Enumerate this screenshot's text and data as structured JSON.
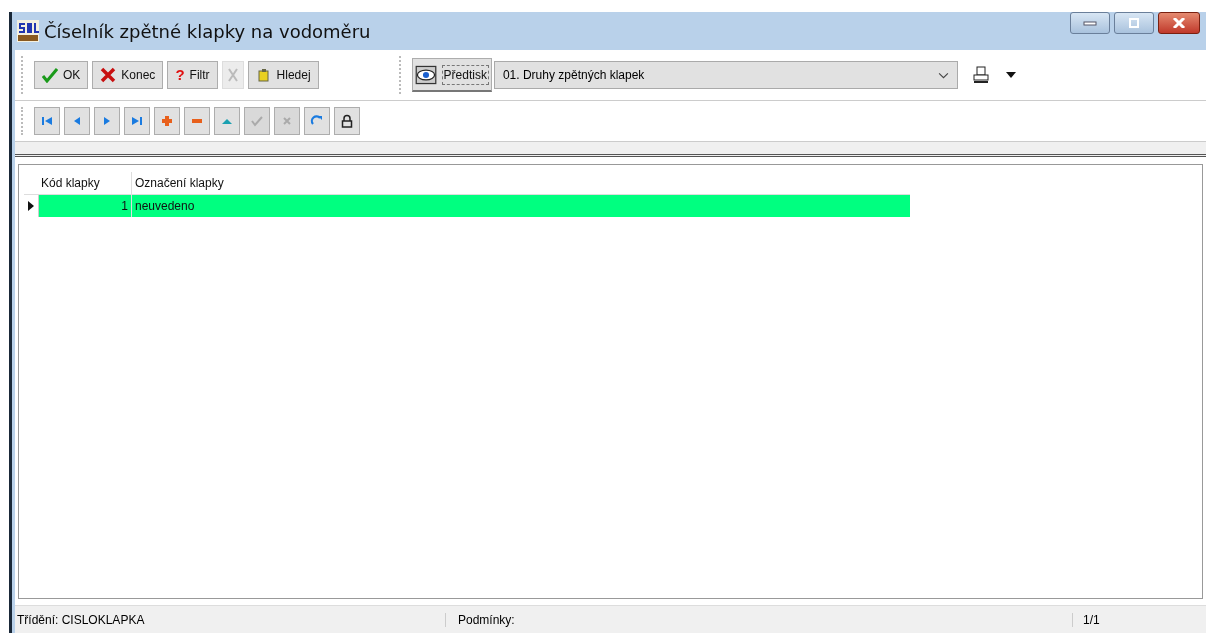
{
  "window": {
    "title": "Číselník zpětné klapky na vodoměru"
  },
  "toolbar": [
    {
      "kind": "ok",
      "label": "OK",
      "disabled": false
    },
    {
      "kind": "close",
      "label": "Konec",
      "disabled": false
    },
    {
      "kind": "filter",
      "symbol": "?",
      "label": "Filtr",
      "disabled": false
    },
    {
      "kind": "cut",
      "disabled": true
    },
    {
      "kind": "find",
      "label": "Hledej",
      "disabled": false
    }
  ],
  "print": {
    "button": "Předtisk",
    "report": "01. Druhy zpětných klapek"
  },
  "nav": [
    {
      "kind": "first",
      "disabled": false
    },
    {
      "kind": "prev",
      "disabled": false
    },
    {
      "kind": "next",
      "disabled": false
    },
    {
      "kind": "last",
      "disabled": false
    },
    {
      "kind": "add",
      "disabled": false
    },
    {
      "kind": "remove",
      "disabled": false
    },
    {
      "kind": "edit",
      "disabled": false
    },
    {
      "kind": "post",
      "disabled": true
    },
    {
      "kind": "cancel",
      "disabled": true
    },
    {
      "kind": "refresh",
      "disabled": false
    },
    {
      "kind": "lock",
      "disabled": false
    }
  ],
  "table": {
    "columns": [
      "Kód klapky",
      "Označení klapky"
    ],
    "rows": [
      {
        "cells": [
          "1",
          "neuvedeno"
        ],
        "selected": true
      }
    ]
  },
  "status_bar": {
    "sort": "Třídění: CISLOKLAPKA",
    "conditions": "Podmínky:",
    "position": "1/1"
  }
}
